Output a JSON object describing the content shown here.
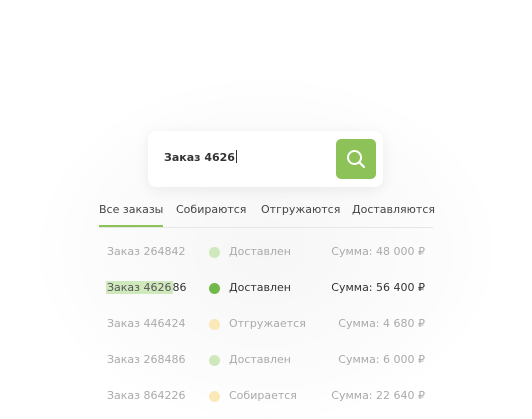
{
  "search": {
    "value": "Заказ 4626",
    "button_icon": "search-icon",
    "button_color": "#8cc257"
  },
  "tabs": [
    {
      "label": "Все заказы",
      "active": true
    },
    {
      "label": "Собираются",
      "active": false
    },
    {
      "label": "Отгружаются",
      "active": false
    },
    {
      "label": "Доставляются",
      "active": false
    }
  ],
  "colors": {
    "accent": "#8cc257",
    "status_delivered": "#cfe8bc",
    "status_delivered_selected": "#72b84b",
    "status_pending": "#fbe8b8"
  },
  "orders": [
    {
      "number_prefix": "",
      "number_highlight": "",
      "number_rest": "Заказ 264842",
      "status": "Доставлен",
      "status_color": "#cfe8bc",
      "sum": "Сумма: 48 000 ₽",
      "selected": false
    },
    {
      "number_prefix": "",
      "number_highlight": "Заказ 4626",
      "number_rest": "86",
      "status": "Доставлен",
      "status_color": "#72b84b",
      "sum": "Сумма: 56 400 ₽",
      "selected": true
    },
    {
      "number_prefix": "",
      "number_highlight": "",
      "number_rest": "Заказ 446424",
      "status": "Отгружается",
      "status_color": "#fbe8b8",
      "sum": "Сумма: 4 680 ₽",
      "selected": false
    },
    {
      "number_prefix": "",
      "number_highlight": "",
      "number_rest": "Заказ 268486",
      "status": "Доставлен",
      "status_color": "#cfe8bc",
      "sum": "Сумма: 6 000 ₽",
      "selected": false
    },
    {
      "number_prefix": "",
      "number_highlight": "",
      "number_rest": "Заказ 864226",
      "status": "Собирается",
      "status_color": "#fbe8b8",
      "sum": "Сумма: 22 640 ₽",
      "selected": false
    }
  ]
}
